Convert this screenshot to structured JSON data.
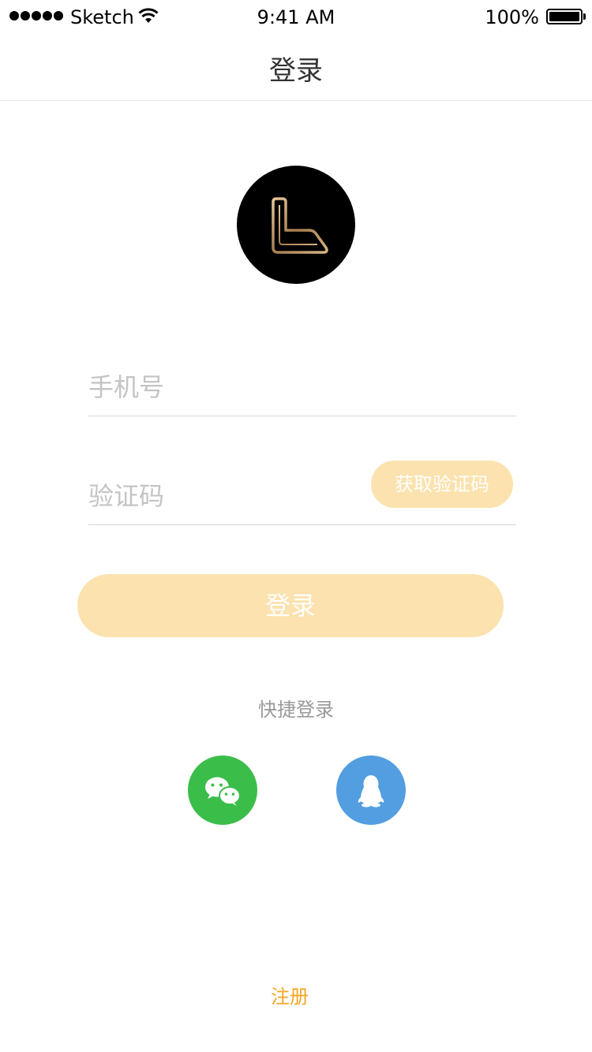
{
  "status_bar": {
    "carrier": "Sketch",
    "time": "9:41 AM",
    "battery": "100%"
  },
  "nav": {
    "title": "登录"
  },
  "form": {
    "phone_placeholder": "手机号",
    "code_placeholder": "验证码",
    "get_code_label": "获取验证码",
    "login_label": "登录"
  },
  "quick_login": {
    "label": "快捷登录",
    "providers": [
      {
        "icon": "wechat-icon",
        "color": "#3bbd4a"
      },
      {
        "icon": "qq-icon",
        "color": "#529ee0"
      }
    ]
  },
  "register": {
    "label": "注册"
  },
  "colors": {
    "accent_soft": "#fbe2ae",
    "link": "#f5a623",
    "wechat": "#3bbd4a",
    "qq": "#529ee0"
  }
}
